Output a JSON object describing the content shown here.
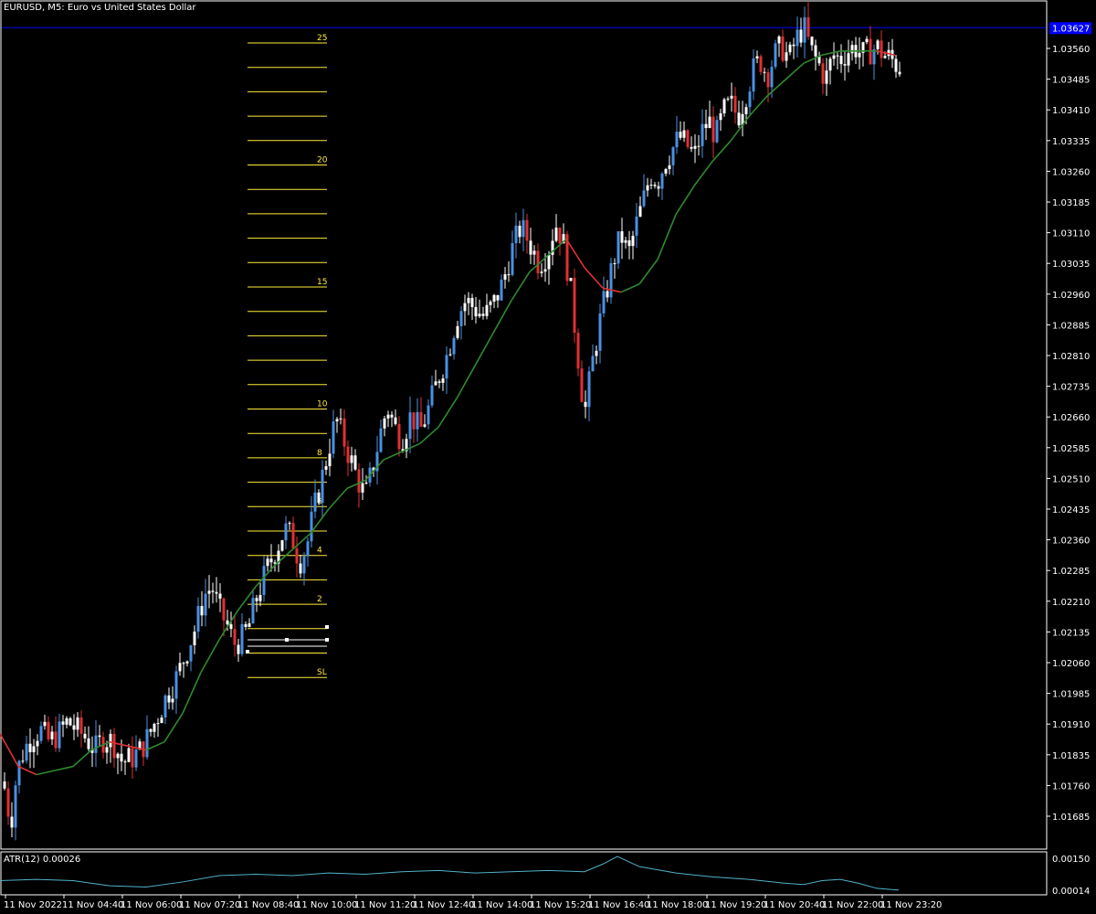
{
  "header": {
    "title": "EURUSD, M5:  Euro vs United States Dollar"
  },
  "atr_panel": {
    "label": "ATR(12) 0.00026",
    "ticks": [
      "0.00150",
      "0.00014"
    ],
    "color": "#4fb3c9"
  },
  "price_axis": {
    "current_price_label": "1.03627",
    "current_price_color": "#0000ff",
    "ticks": [
      "1.03560",
      "1.03485",
      "1.03410",
      "1.03335",
      "1.03260",
      "1.03185",
      "1.03110",
      "1.03035",
      "1.02960",
      "1.02885",
      "1.02810",
      "1.02735",
      "1.02660",
      "1.02585",
      "1.02510",
      "1.02435",
      "1.02360",
      "1.02285",
      "1.02210",
      "1.02135",
      "1.02060",
      "1.01985",
      "1.01910",
      "1.01835",
      "1.01760",
      "1.01685"
    ]
  },
  "time_axis": {
    "ticks": [
      "11 Nov 2022",
      "11 Nov 04:40",
      "11 Nov 06:00",
      "11 Nov 07:20",
      "11 Nov 08:40",
      "11 Nov 10:00",
      "11 Nov 11:20",
      "11 Nov 12:40",
      "11 Nov 14:00",
      "11 Nov 15:20",
      "11 Nov 16:40",
      "11 Nov 18:00",
      "11 Nov 19:20",
      "11 Nov 20:40",
      "11 Nov 22:00",
      "11 Nov 23:20"
    ]
  },
  "fib_levels": {
    "labels": [
      {
        "level": 25,
        "text": "25"
      },
      {
        "level": 20,
        "text": "20"
      },
      {
        "level": 15,
        "text": "15"
      },
      {
        "level": 10,
        "text": "10"
      },
      {
        "level": 8,
        "text": "8"
      },
      {
        "level": 6,
        "text": "6"
      },
      {
        "level": 4,
        "text": "4"
      },
      {
        "level": 2,
        "text": "2"
      },
      {
        "level": -1,
        "text": "SL"
      }
    ],
    "color": "#ffeb3b"
  },
  "colors": {
    "bull_candle": "#4a90e2",
    "bear_candle": "#e03131",
    "neutral_candle": "#ffffff",
    "ma_up": "#2e8b2e",
    "ma_down": "#e03131",
    "price_line": "#0000ff"
  },
  "chart_data": {
    "type": "candlestick",
    "symbol": "EURUSD",
    "timeframe": "M5",
    "ylim": [
      1.0162,
      1.0365
    ],
    "current_price": 1.03627,
    "close_path": [
      [
        0,
        1.0185
      ],
      [
        6,
        1.0175
      ],
      [
        12,
        1.0168
      ],
      [
        18,
        1.018
      ],
      [
        26,
        1.0186
      ],
      [
        34,
        1.0189
      ],
      [
        44,
        1.0191
      ],
      [
        54,
        1.0188
      ],
      [
        64,
        1.019
      ],
      [
        74,
        1.0193
      ],
      [
        84,
        1.0191
      ],
      [
        94,
        1.0189
      ],
      [
        104,
        1.0186
      ],
      [
        114,
        1.0189
      ],
      [
        124,
        1.0188
      ],
      [
        134,
        1.0183
      ],
      [
        144,
        1.0184
      ],
      [
        154,
        1.0186
      ],
      [
        164,
        1.019
      ],
      [
        174,
        1.0195
      ],
      [
        184,
        1.02
      ],
      [
        194,
        1.0204
      ],
      [
        204,
        1.021
      ],
      [
        214,
        1.0216
      ],
      [
        224,
        1.0224
      ],
      [
        232,
        1.0226
      ],
      [
        240,
        1.022
      ],
      [
        248,
        1.0217
      ],
      [
        256,
        1.0212
      ],
      [
        264,
        1.0213
      ],
      [
        272,
        1.0216
      ],
      [
        282,
        1.0224
      ],
      [
        292,
        1.023
      ],
      [
        302,
        1.0235
      ],
      [
        312,
        1.024
      ],
      [
        320,
        1.0238
      ],
      [
        328,
        1.0232
      ],
      [
        336,
        1.0236
      ],
      [
        344,
        1.0245
      ],
      [
        352,
        1.0252
      ],
      [
        360,
        1.026
      ],
      [
        368,
        1.0267
      ],
      [
        376,
        1.0262
      ],
      [
        384,
        1.0257
      ],
      [
        392,
        1.0252
      ],
      [
        400,
        1.0248
      ],
      [
        408,
        1.0255
      ],
      [
        416,
        1.0263
      ],
      [
        424,
        1.027
      ],
      [
        432,
        1.0265
      ],
      [
        440,
        1.0262
      ],
      [
        450,
        1.0268
      ],
      [
        460,
        1.0264
      ],
      [
        470,
        1.027
      ],
      [
        480,
        1.0277
      ],
      [
        490,
        1.0283
      ],
      [
        500,
        1.0292
      ],
      [
        510,
        1.0296
      ],
      [
        520,
        1.0294
      ],
      [
        530,
        1.0292
      ],
      [
        540,
        1.0295
      ],
      [
        550,
        1.03
      ],
      [
        560,
        1.0308
      ],
      [
        570,
        1.0314
      ],
      [
        580,
        1.031
      ],
      [
        590,
        1.0305
      ],
      [
        600,
        1.0308
      ],
      [
        608,
        1.0315
      ],
      [
        616,
        1.0311
      ],
      [
        624,
        1.03
      ],
      [
        632,
        1.0284
      ],
      [
        640,
        1.0268
      ],
      [
        648,
        1.028
      ],
      [
        656,
        1.029
      ],
      [
        664,
        1.0298
      ],
      [
        672,
        1.0306
      ],
      [
        680,
        1.0312
      ],
      [
        688,
        1.0307
      ],
      [
        696,
        1.0314
      ],
      [
        704,
        1.032
      ],
      [
        712,
        1.0327
      ],
      [
        720,
        1.0325
      ],
      [
        728,
        1.033
      ],
      [
        736,
        1.0333
      ],
      [
        744,
        1.0336
      ],
      [
        752,
        1.0334
      ],
      [
        760,
        1.0331
      ],
      [
        768,
        1.0337
      ],
      [
        776,
        1.034
      ],
      [
        784,
        1.0336
      ],
      [
        792,
        1.0342
      ],
      [
        800,
        1.0344
      ],
      [
        808,
        1.0341
      ],
      [
        816,
        1.0346
      ],
      [
        824,
        1.0352
      ],
      [
        832,
        1.0355
      ],
      [
        840,
        1.0351
      ],
      [
        848,
        1.0356
      ],
      [
        856,
        1.0358
      ],
      [
        864,
        1.0355
      ],
      [
        872,
        1.036
      ],
      [
        880,
        1.0363
      ],
      [
        888,
        1.0357
      ],
      [
        896,
        1.0354
      ],
      [
        904,
        1.035
      ],
      [
        912,
        1.0356
      ],
      [
        920,
        1.0355
      ],
      [
        928,
        1.0357
      ],
      [
        936,
        1.0358
      ],
      [
        944,
        1.0356
      ],
      [
        952,
        1.0357
      ],
      [
        960,
        1.0358
      ],
      [
        968,
        1.0356
      ],
      [
        976,
        1.0355
      ],
      [
        984,
        1.0353
      ]
    ],
    "ma_path": [
      [
        0,
        1.019
      ],
      [
        20,
        1.0182
      ],
      [
        40,
        1.018
      ],
      [
        60,
        1.0181
      ],
      [
        80,
        1.0182
      ],
      [
        100,
        1.0186
      ],
      [
        120,
        1.0188
      ],
      [
        140,
        1.0187
      ],
      [
        160,
        1.0186
      ],
      [
        180,
        1.0188
      ],
      [
        200,
        1.0195
      ],
      [
        220,
        1.0205
      ],
      [
        240,
        1.0213
      ],
      [
        260,
        1.022
      ],
      [
        280,
        1.0226
      ],
      [
        300,
        1.0231
      ],
      [
        320,
        1.0235
      ],
      [
        340,
        1.0239
      ],
      [
        360,
        1.0245
      ],
      [
        380,
        1.025
      ],
      [
        400,
        1.0252
      ],
      [
        420,
        1.0257
      ],
      [
        440,
        1.0259
      ],
      [
        460,
        1.0261
      ],
      [
        480,
        1.0265
      ],
      [
        500,
        1.0272
      ],
      [
        520,
        1.028
      ],
      [
        540,
        1.0288
      ],
      [
        560,
        1.0296
      ],
      [
        580,
        1.0303
      ],
      [
        600,
        1.0307
      ],
      [
        620,
        1.0311
      ],
      [
        640,
        1.0304
      ],
      [
        660,
        1.0299
      ],
      [
        680,
        1.0298
      ],
      [
        700,
        1.03
      ],
      [
        720,
        1.0306
      ],
      [
        740,
        1.0317
      ],
      [
        760,
        1.0324
      ],
      [
        780,
        1.033
      ],
      [
        800,
        1.0335
      ],
      [
        820,
        1.0341
      ],
      [
        840,
        1.0346
      ],
      [
        860,
        1.035
      ],
      [
        880,
        1.0354
      ],
      [
        900,
        1.0356
      ],
      [
        920,
        1.0357
      ],
      [
        940,
        1.0357
      ],
      [
        960,
        1.0357
      ],
      [
        980,
        1.0356
      ]
    ],
    "atr_path": [
      [
        0,
        0.00055
      ],
      [
        40,
        0.0006
      ],
      [
        80,
        0.00055
      ],
      [
        120,
        0.00035
      ],
      [
        160,
        0.0003
      ],
      [
        200,
        0.0005
      ],
      [
        240,
        0.00075
      ],
      [
        280,
        0.0008
      ],
      [
        320,
        0.00075
      ],
      [
        360,
        0.00085
      ],
      [
        400,
        0.0008
      ],
      [
        440,
        0.0009
      ],
      [
        480,
        0.00095
      ],
      [
        520,
        0.00085
      ],
      [
        560,
        0.0009
      ],
      [
        600,
        0.00095
      ],
      [
        640,
        0.0009
      ],
      [
        660,
        0.0012
      ],
      [
        676,
        0.0015
      ],
      [
        700,
        0.0011
      ],
      [
        740,
        0.00085
      ],
      [
        780,
        0.0007
      ],
      [
        820,
        0.0006
      ],
      [
        860,
        0.00045
      ],
      [
        880,
        0.0004
      ],
      [
        900,
        0.00055
      ],
      [
        920,
        0.0006
      ],
      [
        940,
        0.00045
      ],
      [
        960,
        0.00025
      ],
      [
        984,
        0.00018
      ]
    ]
  }
}
